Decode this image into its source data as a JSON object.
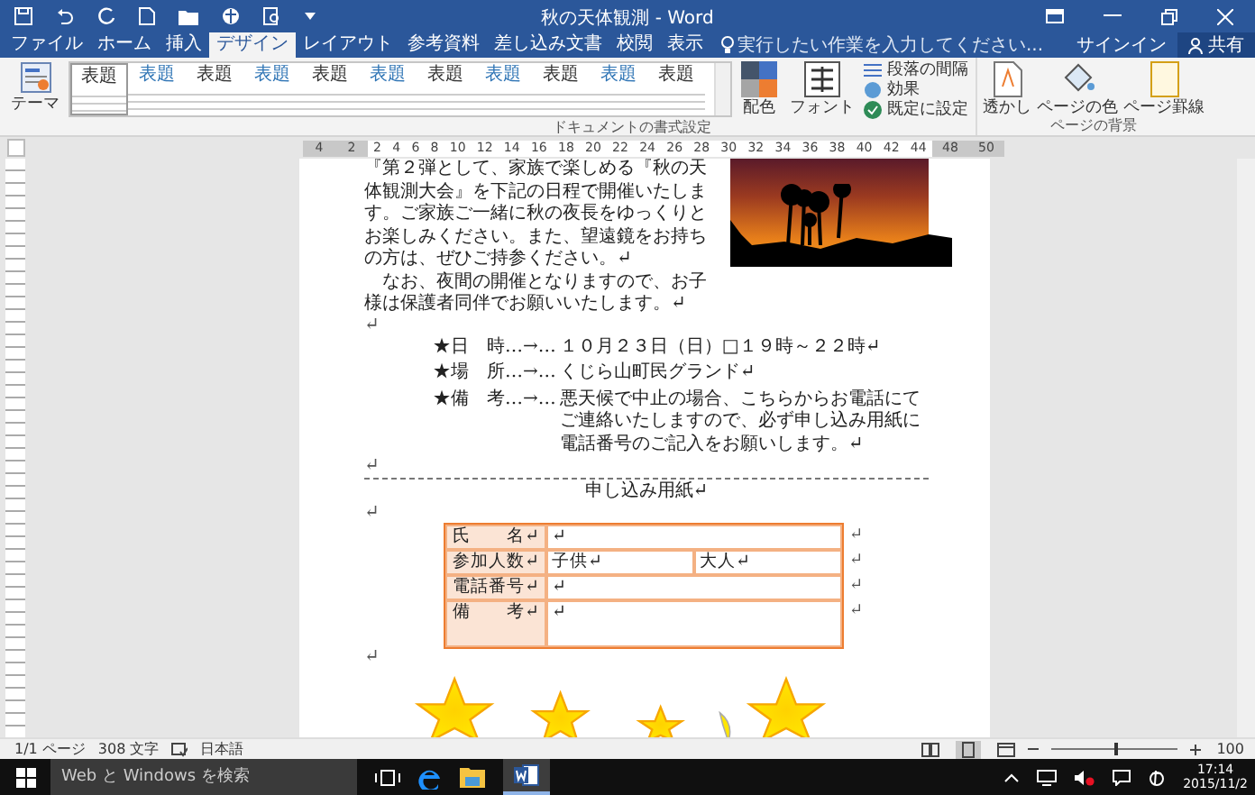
{
  "window": {
    "title": "秋の天体観測 - Word"
  },
  "ribbon_tabs": [
    {
      "label": "ファイル",
      "selected": false
    },
    {
      "label": "ホーム",
      "selected": false
    },
    {
      "label": "挿入",
      "selected": false
    },
    {
      "label": "デザイン",
      "selected": true
    },
    {
      "label": "レイアウト",
      "selected": false
    },
    {
      "label": "参考資料",
      "selected": false
    },
    {
      "label": "差し込み文書",
      "selected": false
    },
    {
      "label": "校閲",
      "selected": false
    },
    {
      "label": "表示",
      "selected": false
    }
  ],
  "tell_me": {
    "placeholder": "実行したい作業を入力してください..."
  },
  "account": {
    "sign_in": "サインイン",
    "share": "共有"
  },
  "ribbon": {
    "theme_label": "テーマ",
    "style_gallery": [
      {
        "title": "表題"
      },
      {
        "title": "表題"
      },
      {
        "title": "表題"
      },
      {
        "title": "表題"
      },
      {
        "title": "表題"
      },
      {
        "title": "表題"
      },
      {
        "title": "表題"
      },
      {
        "title": "表題"
      },
      {
        "title": "表題"
      },
      {
        "title": "表題"
      },
      {
        "title": "表題"
      }
    ],
    "colors_label": "配色",
    "fonts_label": "フォント",
    "paragraph_spacing": "段落の間隔",
    "effects": "効果",
    "set_default": "既定に設定",
    "group_document_formatting": "ドキュメントの書式設定",
    "watermark": "透かし",
    "page_color": "ページの色",
    "page_borders": "ページ罫線",
    "group_page_background": "ページの背景"
  },
  "ruler": {
    "left_numbers": [
      "4",
      "2"
    ],
    "numbers": [
      "2",
      "4",
      "6",
      "8",
      "10",
      "12",
      "14",
      "16",
      "18",
      "20",
      "22",
      "24",
      "26",
      "28",
      "30",
      "32",
      "34",
      "36",
      "38",
      "40",
      "42",
      "44"
    ],
    "right_numbers": [
      "48",
      "50"
    ]
  },
  "document": {
    "paragraphs": [
      "『第２弾として、家族で楽しめる『秋の天体観測大会』を下記の日程で開催いたします。ご家族ご一緒に秋の夜長をゆっくりとお楽しみください。また、望遠鏡をお持ちの方は、ぜひご持参ください。↵",
      "　なお、夜間の開催となりますので、お子様は保護者同伴でお願いいたします。↵"
    ],
    "mark_after_body": "↵",
    "details": [
      {
        "bullet": "★",
        "label": "日　時",
        "tab_mark": "…→…",
        "value": "１０月２３日（日）□１９時～２２時↵"
      },
      {
        "bullet": "★",
        "label": "場　所",
        "tab_mark": "…→…",
        "value": "くじら山町民グランド↵"
      },
      {
        "bullet": "★",
        "label": "備　考",
        "tab_mark": "…→…",
        "value": "悪天候で中止の場合、こちらからお電話にてご連絡いたしますので、必ず申し込み用紙に電話番号のご記入をお願いします。↵"
      }
    ],
    "mark_before_divider": "↵",
    "section_title": "申し込み用紙↵",
    "mark_before_table": "↵",
    "form_table": {
      "rows": [
        {
          "kind": "normal",
          "label": "氏　　名↵",
          "cells": [
            "↵"
          ],
          "end_mark": "↵"
        },
        {
          "kind": "normal",
          "label": "参加人数↵",
          "cells": [
            "子供↵",
            "大人↵"
          ],
          "end_mark": "↵"
        },
        {
          "kind": "normal",
          "label": "電話番号↵",
          "cells": [
            "↵"
          ],
          "end_mark": "↵"
        },
        {
          "kind": "tall",
          "label": "備　　考↵",
          "cells": [
            "↵"
          ],
          "end_mark": "↵"
        }
      ]
    },
    "mark_after_table": "↵"
  },
  "status_bar": {
    "page": "1/1 ページ",
    "words": "308 文字",
    "language": "日本語",
    "zoom": "100",
    "zoom_slider": {
      "level": 0.5
    }
  },
  "taskbar": {
    "search_placeholder": "Web と Windows を検索",
    "time": "17:14",
    "date": "2015/11/2"
  }
}
